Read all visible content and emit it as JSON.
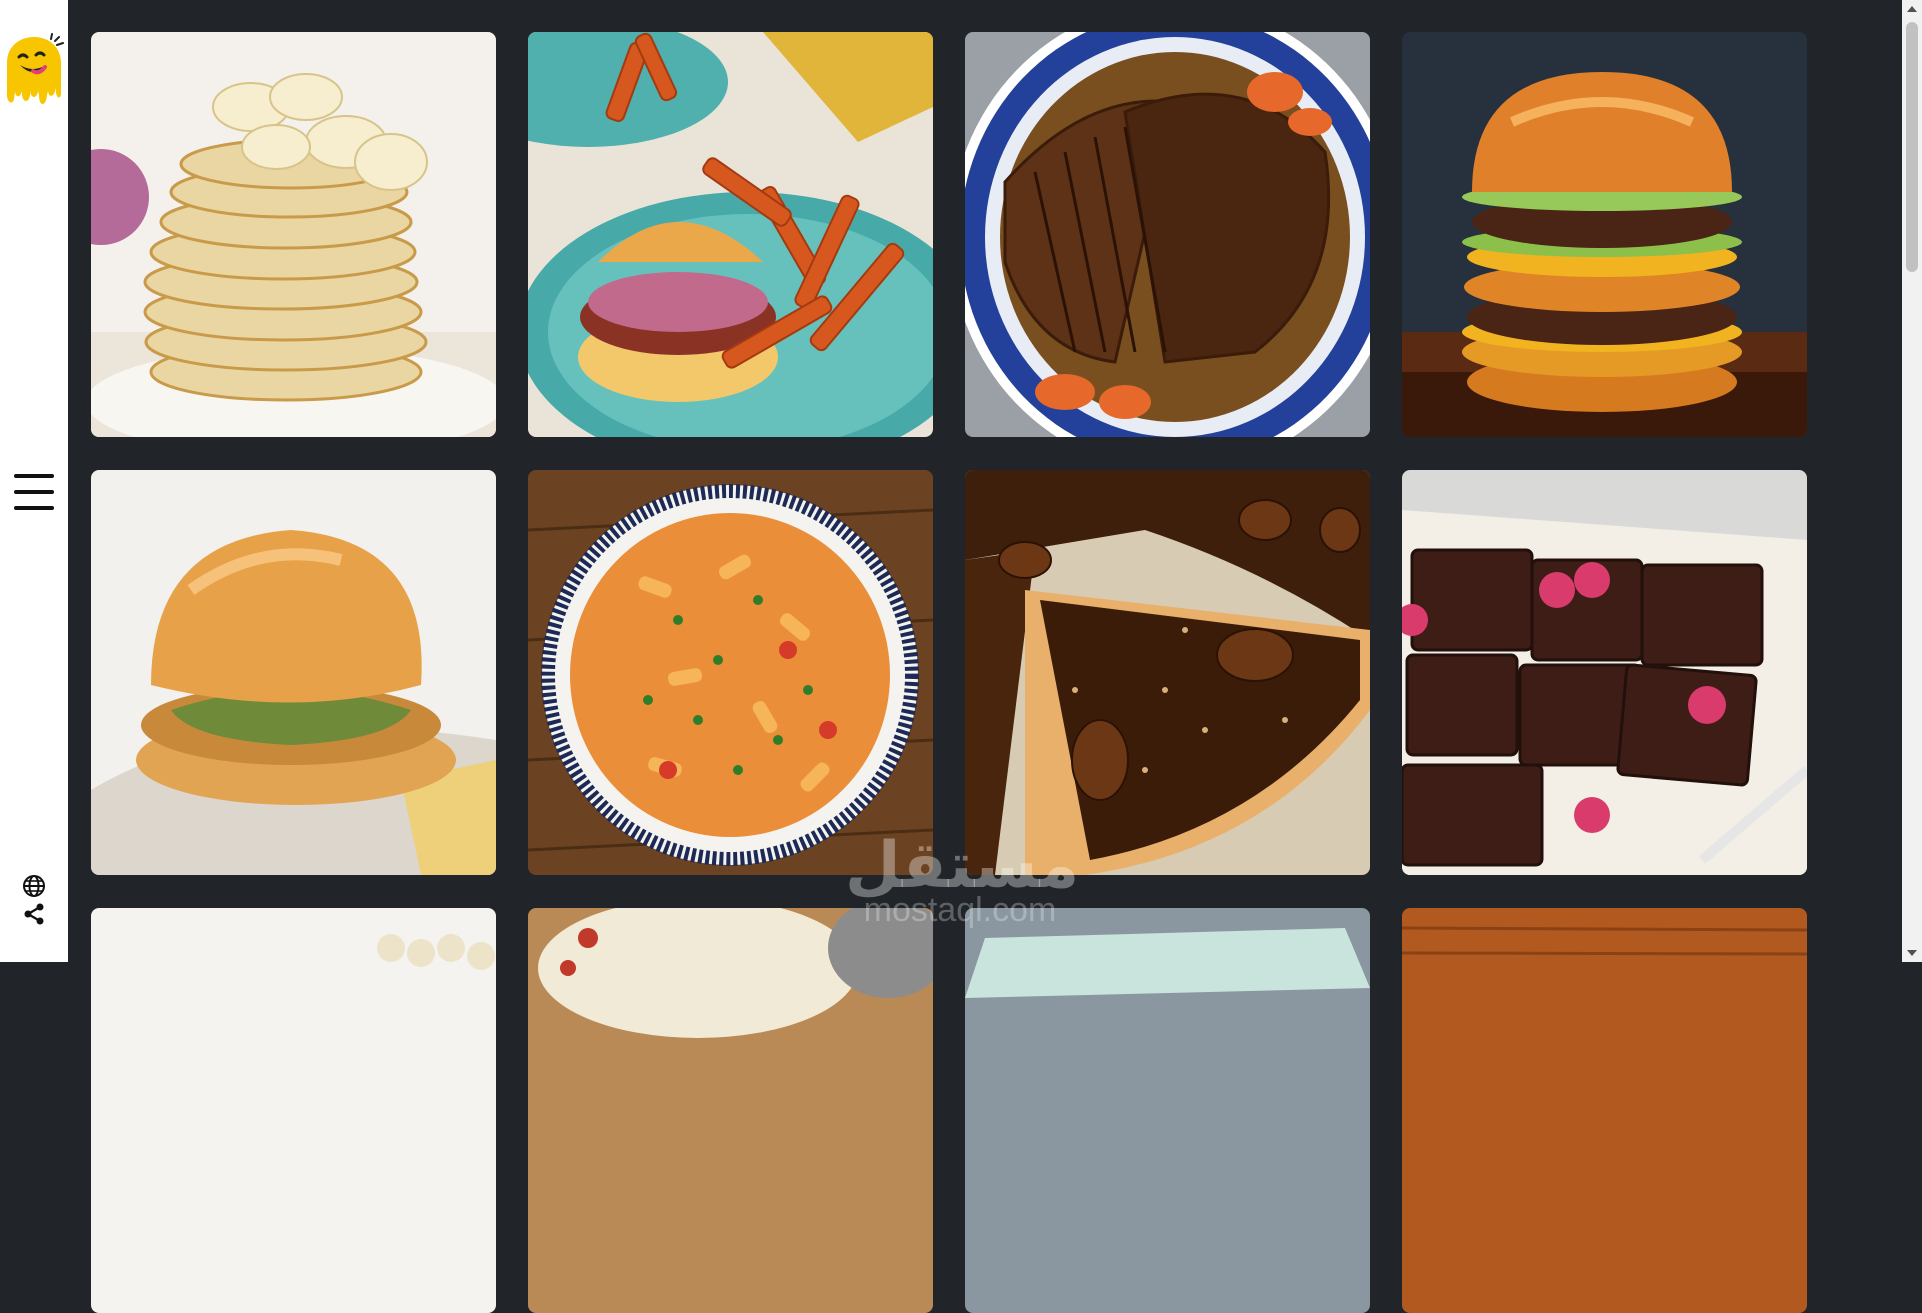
{
  "sidebar": {
    "logo_icon": "smiley-drip-logo",
    "menu_icon": "hamburger-menu-icon",
    "language_icon": "globe-icon",
    "share_icon": "share-icon"
  },
  "gallery": {
    "items": [
      {
        "name": "pancakes-stack",
        "icon": "food-image"
      },
      {
        "name": "burger-sweet-potato-fries",
        "icon": "food-image"
      },
      {
        "name": "sliced-pot-roast",
        "icon": "food-image"
      },
      {
        "name": "double-cheeseburger",
        "icon": "food-image"
      },
      {
        "name": "chicken-sandwich",
        "icon": "food-image"
      },
      {
        "name": "pasta-bowl",
        "icon": "food-image"
      },
      {
        "name": "pecan-pie",
        "icon": "food-image"
      },
      {
        "name": "chocolate-brownies",
        "icon": "food-image"
      },
      {
        "name": "dough-balls",
        "icon": "food-image"
      },
      {
        "name": "potato-salad",
        "icon": "food-image"
      },
      {
        "name": "wrapped-dish",
        "icon": "food-image"
      },
      {
        "name": "wooden-board",
        "icon": "food-image"
      }
    ]
  },
  "watermark": {
    "arabic": "مستقل",
    "latin": "mostaql.com"
  },
  "colors": {
    "background": "#212529",
    "sidebar": "#ffffff",
    "logo_yellow": "#f7c600"
  }
}
